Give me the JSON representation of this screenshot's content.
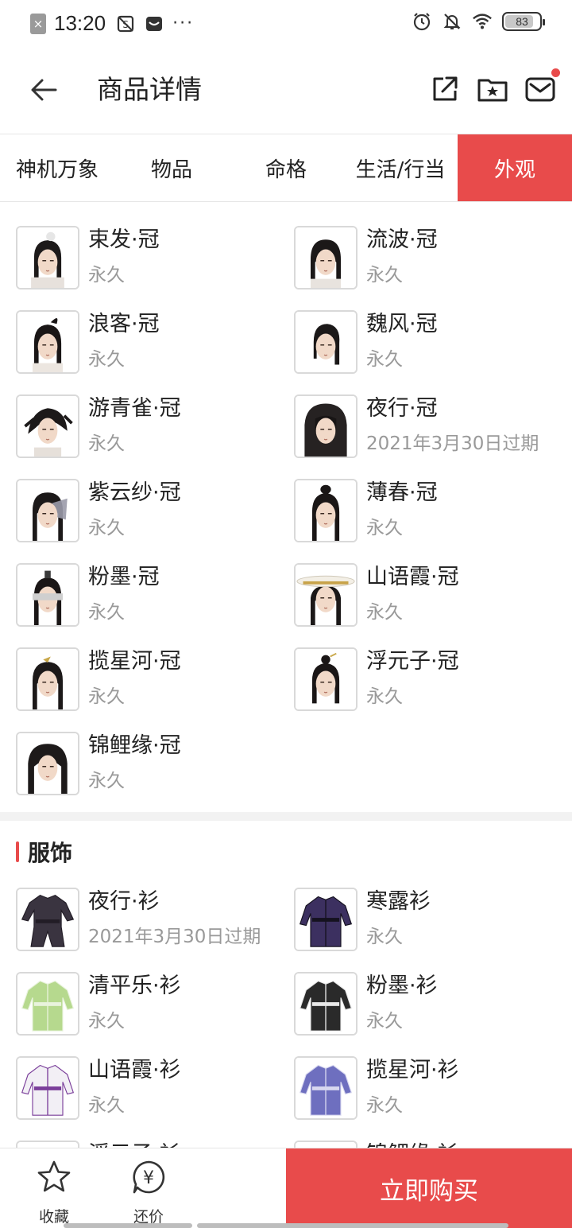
{
  "status_bar": {
    "time": "13:20",
    "x_badge": "×",
    "dots": "···",
    "battery": "83",
    "battery_level": 0.83
  },
  "header": {
    "title": "商品详情"
  },
  "tabs": [
    {
      "label": "神机万象",
      "active": false
    },
    {
      "label": "物品",
      "active": false
    },
    {
      "label": "命格",
      "active": false
    },
    {
      "label": "生活/行当",
      "active": false
    },
    {
      "label": "外观",
      "active": true
    }
  ],
  "hats": [
    {
      "name": "束发·冠",
      "duration": "永久",
      "icon": "hair-bun-icon"
    },
    {
      "name": "流波·冠",
      "duration": "永久",
      "icon": "long-hair-icon"
    },
    {
      "name": "浪客·冠",
      "duration": "永久",
      "icon": "ponytail-icon"
    },
    {
      "name": "魏风·冠",
      "duration": "永久",
      "icon": "short-hair-icon"
    },
    {
      "name": "游青雀·冠",
      "duration": "永久",
      "icon": "wild-hair-icon"
    },
    {
      "name": "夜行·冠",
      "duration": "2021年3月30日过期",
      "icon": "hood-icon"
    },
    {
      "name": "紫云纱·冠",
      "duration": "永久",
      "icon": "veil-hair-icon"
    },
    {
      "name": "薄春·冠",
      "duration": "永久",
      "icon": "topknot-icon"
    },
    {
      "name": "粉墨·冠",
      "duration": "永久",
      "icon": "blindfold-icon"
    },
    {
      "name": "山语霞·冠",
      "duration": "永久",
      "icon": "straw-hat-icon"
    },
    {
      "name": "揽星河·冠",
      "duration": "永久",
      "icon": "hairpin-icon"
    },
    {
      "name": "浮元子·冠",
      "duration": "永久",
      "icon": "bun-ornament-icon"
    },
    {
      "name": "锦鲤缘·冠",
      "duration": "永久",
      "icon": "flowing-hair-icon"
    }
  ],
  "clothing_section": {
    "title": "服饰"
  },
  "clothes": [
    {
      "name": "夜行·衫",
      "duration": "2021年3月30日过期",
      "icon": "dark-outfit-icon",
      "color": "#3a3440"
    },
    {
      "name": "寒露衫",
      "duration": "永久",
      "icon": "purple-robe-icon",
      "color": "#3c3060"
    },
    {
      "name": "清平乐·衫",
      "duration": "永久",
      "icon": "green-robe-icon",
      "color": "#b6d98e"
    },
    {
      "name": "粉墨·衫",
      "duration": "永久",
      "icon": "ink-robe-icon",
      "color": "#2a2a2a"
    },
    {
      "name": "山语霞·衫",
      "duration": "永久",
      "icon": "white-purple-robe-icon",
      "color": "#7a3e9a"
    },
    {
      "name": "揽星河·衫",
      "duration": "永久",
      "icon": "blue-robe-icon",
      "color": "#6e6fbf"
    },
    {
      "name": "浮元子·衫",
      "duration": "",
      "icon": "robe-icon",
      "color": "#c9c9c9"
    },
    {
      "name": "锦鲤缘·衫",
      "duration": "",
      "icon": "robe-icon",
      "color": "#9a9a9a"
    }
  ],
  "bottom_bar": {
    "favorite_label": "收藏",
    "bargain_label": "还价",
    "bargain_symbol": "¥",
    "buy_label": "立即购买"
  },
  "colors": {
    "accent": "#e84b4b",
    "text_primary": "#222222",
    "text_secondary": "#999999"
  }
}
